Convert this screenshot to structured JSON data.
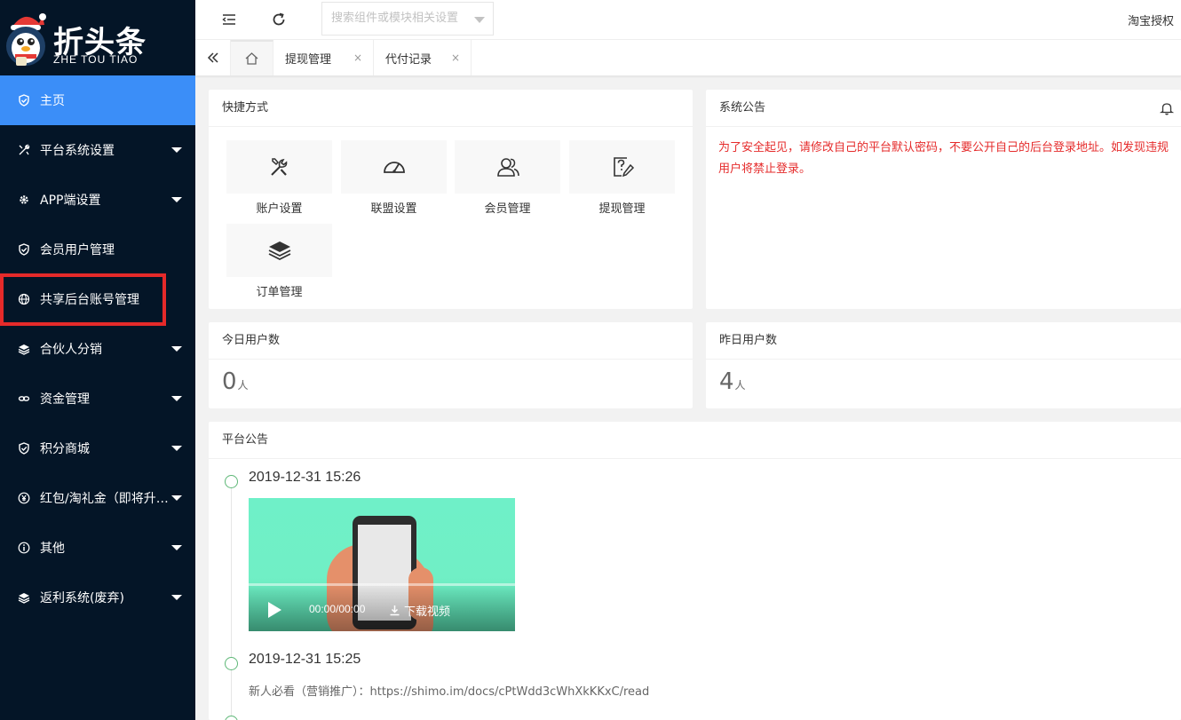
{
  "logo": {
    "title": "折头条",
    "subtitle": "ZHE TOU TIAO"
  },
  "sidebar": {
    "items": [
      {
        "label": "主页",
        "icon": "shield-check-icon"
      },
      {
        "label": "平台系统设置",
        "icon": "tools-icon"
      },
      {
        "label": "APP端设置",
        "icon": "gear-icon"
      },
      {
        "label": "会员用户管理",
        "icon": "shield-check-icon"
      },
      {
        "label": "共享后台账号管理",
        "icon": "globe-icon"
      },
      {
        "label": "合伙人分销",
        "icon": "layers-icon"
      },
      {
        "label": "资金管理",
        "icon": "link-icon"
      },
      {
        "label": "积分商城",
        "icon": "shield-check-icon"
      },
      {
        "label": "红包/淘礼金（即将升…",
        "icon": "yen-icon"
      },
      {
        "label": "其他",
        "icon": "info-icon"
      },
      {
        "label": "返利系统(废弃)",
        "icon": "layers-icon"
      }
    ],
    "active_color": "#3b8ef8",
    "highlight_color": "#e62a2a"
  },
  "header": {
    "search_placeholder": "搜索组件或模块相关设置",
    "auth_label": "淘宝授权"
  },
  "tabs": [
    {
      "label": "提现管理",
      "close": "×"
    },
    {
      "label": "代付记录",
      "close": "×"
    }
  ],
  "shortcuts": {
    "title": "快捷方式",
    "items": [
      {
        "label": "账户设置",
        "icon": "tools-icon"
      },
      {
        "label": "联盟设置",
        "icon": "dashboard-icon"
      },
      {
        "label": "会员管理",
        "icon": "users-icon"
      },
      {
        "label": "提现管理",
        "icon": "help-edit-icon"
      },
      {
        "label": "订单管理",
        "icon": "layers-icon"
      }
    ]
  },
  "system_notice": {
    "title": "系统公告",
    "text": "为了安全起见，请修改自己的平台默认密码，不要公开自己的后台登录地址。如发现违规用户将禁止登录。"
  },
  "stats": {
    "today": {
      "title": "今日用户数",
      "value": "0",
      "unit": "人"
    },
    "yesterday": {
      "title": "昨日用户数",
      "value": "4",
      "unit": "人"
    }
  },
  "platform_notice": {
    "title": "平台公告",
    "items": [
      {
        "time": "2019-12-31 15:26",
        "video_time": "00:00/00:00",
        "download_label": "下载视频"
      },
      {
        "time": "2019-12-31 15:25",
        "text": "新人必看（营销推广）：https://shimo.im/docs/cPtWdd3cWhXkKKxC/read"
      }
    ]
  }
}
